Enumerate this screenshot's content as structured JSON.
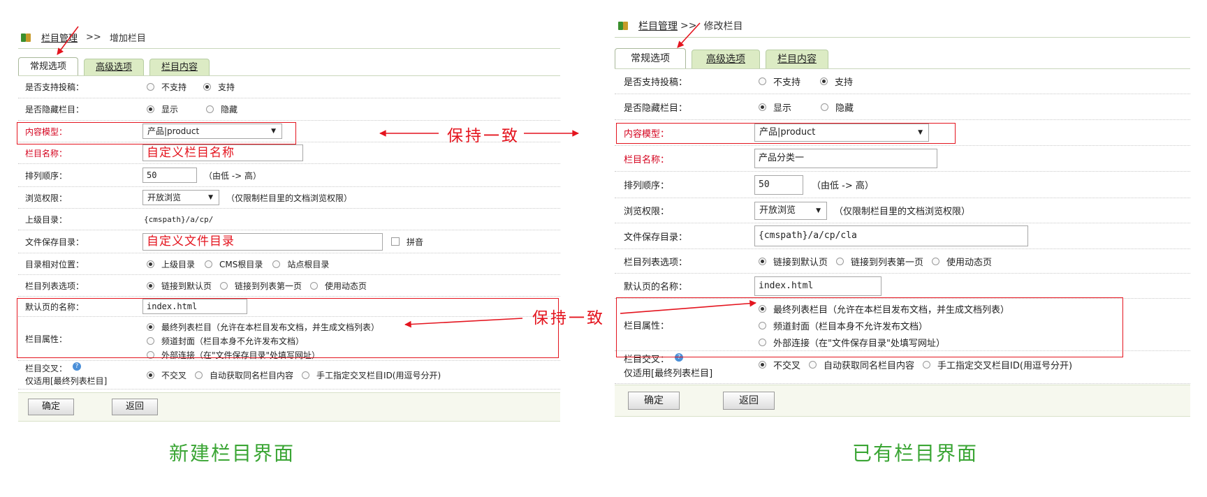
{
  "left": {
    "breadcrumb": {
      "link": "栏目管理",
      "sep": ">>",
      "current": "增加栏目"
    },
    "tabs": [
      "常规选项",
      "高级选项",
      "栏目内容"
    ],
    "fields": {
      "allow_submit": {
        "label": "是否支持投稿：",
        "opt1": "不支持",
        "opt2": "支持"
      },
      "hidden": {
        "label": "是否隐藏栏目：",
        "opt1": "显示",
        "opt2": "隐藏"
      },
      "content_model": {
        "label": "内容模型：",
        "value": "产品|product"
      },
      "column_name": {
        "label": "栏目名称：",
        "value": "自定义栏目名称"
      },
      "sort_order": {
        "label": "排列顺序：",
        "value": "50",
        "note": "（由低 -> 高）"
      },
      "browse": {
        "label": "浏览权限：",
        "value": "开放浏览",
        "note": "（仅限制栏目里的文档浏览权限）"
      },
      "parent_dir": {
        "label": "上级目录：",
        "value": "{cmspath}/a/cp/"
      },
      "save_dir": {
        "label": "文件保存目录：",
        "value": "自定义文件目录",
        "pinyin": "拼音"
      },
      "dir_position": {
        "label": "目录相对位置：",
        "opt1": "上级目录",
        "opt2": "CMS根目录",
        "opt3": "站点根目录"
      },
      "list_option": {
        "label": "栏目列表选项：",
        "opt1": "链接到默认页",
        "opt2": "链接到列表第一页",
        "opt3": "使用动态页"
      },
      "default_page": {
        "label": "默认页的名称：",
        "value": "index.html"
      },
      "attr": {
        "label": "栏目属性：",
        "opt1": "最终列表栏目（允许在本栏目发布文档，并生成文档列表）",
        "opt2": "频道封面（栏目本身不允许发布文档）",
        "opt3": "外部连接（在\"文件保存目录\"处填写网址）"
      },
      "cross": {
        "label": "栏目交叉：",
        "label2": "仅适用[最终列表栏目]",
        "opt1": "不交叉",
        "opt2": "自动获取同名栏目内容",
        "opt3": "手工指定交叉栏目ID(用逗号分开)"
      }
    },
    "buttons": {
      "ok": "确定",
      "back": "返回"
    },
    "caption": "新建栏目界面"
  },
  "right": {
    "breadcrumb": {
      "link": "栏目管理",
      "sep": ">>",
      "current": "修改栏目"
    },
    "tabs": [
      "常规选项",
      "高级选项",
      "栏目内容"
    ],
    "fields": {
      "allow_submit": {
        "label": "是否支持投稿：",
        "opt1": "不支持",
        "opt2": "支持"
      },
      "hidden": {
        "label": "是否隐藏栏目：",
        "opt1": "显示",
        "opt2": "隐藏"
      },
      "content_model": {
        "label": "内容模型：",
        "value": "产品|product"
      },
      "column_name": {
        "label": "栏目名称：",
        "value": "产品分类一"
      },
      "sort_order": {
        "label": "排列顺序：",
        "value": "50",
        "note": "（由低 -> 高）"
      },
      "browse": {
        "label": "浏览权限：",
        "value": "开放浏览",
        "note": "（仅限制栏目里的文档浏览权限）"
      },
      "save_dir": {
        "label": "文件保存目录：",
        "value": "{cmspath}/a/cp/cla"
      },
      "list_option": {
        "label": "栏目列表选项：",
        "opt1": "链接到默认页",
        "opt2": "链接到列表第一页",
        "opt3": "使用动态页"
      },
      "default_page": {
        "label": "默认页的名称：",
        "value": "index.html"
      },
      "attr": {
        "label": "栏目属性：",
        "opt1": "最终列表栏目（允许在本栏目发布文档，并生成文档列表）",
        "opt2": "频道封面（栏目本身不允许发布文档）",
        "opt3": "外部连接（在\"文件保存目录\"处填写网址）"
      },
      "cross": {
        "label": "栏目交叉：",
        "label2": "仅适用[最终列表栏目]",
        "opt1": "不交叉",
        "opt2": "自动获取同名栏目内容",
        "opt3": "手工指定交叉栏目ID(用逗号分开)"
      }
    },
    "buttons": {
      "ok": "确定",
      "back": "返回"
    },
    "caption": "已有栏目界面"
  },
  "annotations": {
    "top": "保持一致",
    "bottom": "保持一致"
  },
  "colors": {
    "annotation_red": "#e4141e",
    "caption_green": "#3aa534",
    "tab_green": "#dcebc4",
    "footer_bg": "#f6f8ee"
  }
}
